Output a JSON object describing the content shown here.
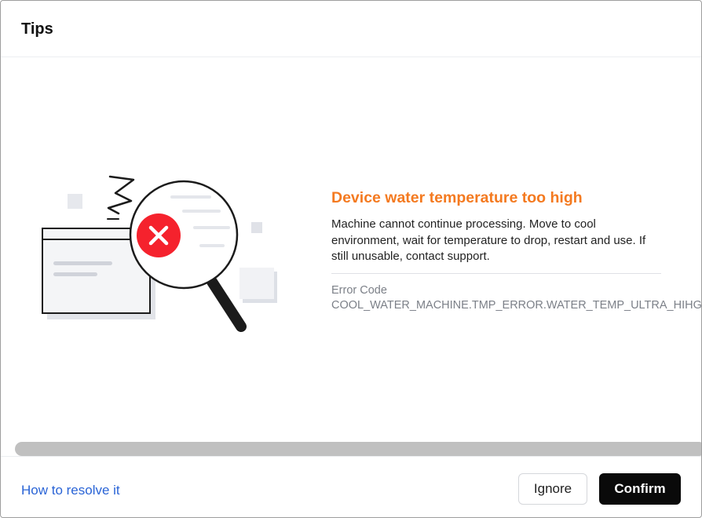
{
  "dialog": {
    "title": "Tips"
  },
  "error": {
    "title": "Device water temperature too high",
    "description": "Machine cannot continue processing. Move to cool environment, wait for temperature to drop, restart and use. If still unusable, contact support.",
    "code_label": "Error Code",
    "code_value": "COOL_WATER_MACHINE.TMP_ERROR.WATER_TEMP_ULTRA_HIHG",
    "icon": "magnifier-error-icon"
  },
  "footer": {
    "help_link": "How to resolve it",
    "ignore_label": "Ignore",
    "confirm_label": "Confirm"
  },
  "colors": {
    "error_title": "#f47a20",
    "error_badge": "#f5222d",
    "link": "#2a64d6",
    "primary_button": "#0a0a0a"
  }
}
